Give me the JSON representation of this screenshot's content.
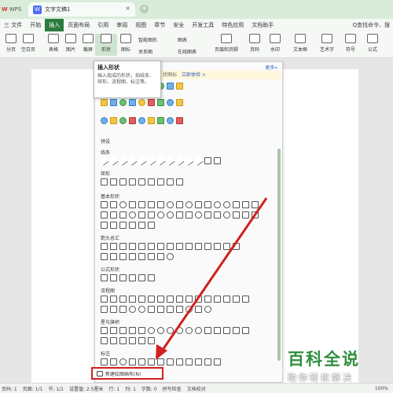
{
  "titlebar": {
    "wps_label": "WPS",
    "doc_tab": "文字文稿1",
    "close": "×",
    "add": "+"
  },
  "menu": {
    "file": "三 文件",
    "items": [
      "开始",
      "插入",
      "页面布局",
      "引用",
      "审阅",
      "视图",
      "章节",
      "安全",
      "开发工具",
      "特色应用",
      "文档助手"
    ],
    "active_index": 1,
    "search": "Q查找命令、搜"
  },
  "toolbar": {
    "buttons": [
      "分页",
      "空白页",
      "表格",
      "图片",
      "截屏",
      "形状",
      "图标",
      "功能图"
    ],
    "smart_graphic": "智能图形",
    "chart": "图表",
    "relation_chart": "关系图",
    "online_chart": "在线图表",
    "header_footer": "页眉和页脚",
    "page_number": "页码",
    "watermark": "水印",
    "textbox": "文本框",
    "art_text": "艺术字",
    "symbol": "符号",
    "formula": "公式"
  },
  "tooltip": {
    "title": "插入形状",
    "body": "插入现成的形状，如线条、矩形、流程图、标注等。"
  },
  "panel": {
    "more": "更多»",
    "banner": "状图标",
    "banner_link": "立即体验 >",
    "preset": "预设",
    "sections": [
      "线条",
      "矩形",
      "基本形状",
      "箭头总汇",
      "公式形状",
      "流程图",
      "星与旗帜",
      "标注"
    ],
    "new_canvas": "新建绘图画布(N)"
  },
  "statusbar": {
    "items": [
      "页码: 1",
      "页面: 1/1",
      "节: 1/1",
      "设置值: 2.5厘米",
      "行: 1",
      "列: 1",
      "字数: 0",
      "拼写检查",
      "文档校对"
    ],
    "zoom": "100%"
  },
  "watermark": {
    "big": "百科全说",
    "small": "助你轻松解决"
  },
  "colors": {
    "accent": "#2b7a3e",
    "highlight": "#d02020"
  }
}
